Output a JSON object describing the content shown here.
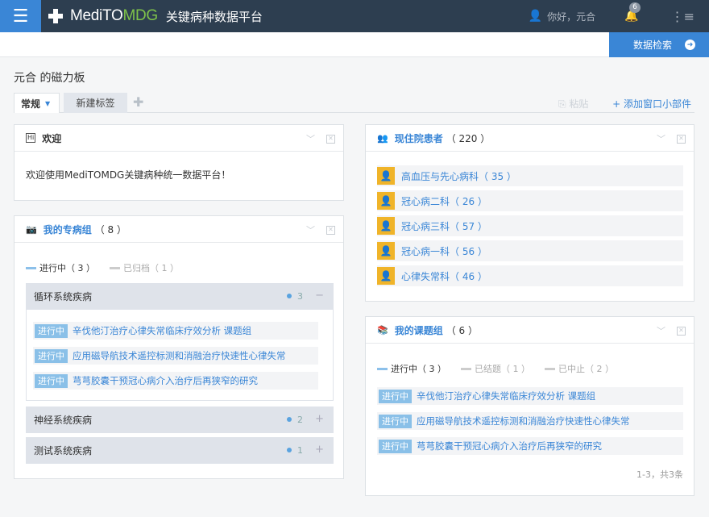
{
  "header": {
    "brand_main": "MediTO",
    "brand_accent": "MDG",
    "platform_title": "关键病种数据平台",
    "greeting": "你好，元合",
    "notification_count": "6"
  },
  "subbar": {
    "search_label": "数据检索"
  },
  "board": {
    "title": "元合 的磁力板"
  },
  "tabs": {
    "items": [
      {
        "label": "常规"
      },
      {
        "label": "新建标签"
      }
    ],
    "paste_label": "粘贴",
    "add_widget_label": "+ 添加窗口小部件"
  },
  "welcome": {
    "title": "欢迎",
    "message": "欢迎使用MediTOMDG关键病种统一数据平台！"
  },
  "disease_groups": {
    "title": "我的专病组",
    "count": "（ 8 ）",
    "filters": [
      {
        "label": "进行中（ 3 ）"
      },
      {
        "label": "已归档（ 1 ）"
      }
    ],
    "groups": [
      {
        "name": "循环系统疾病",
        "count": "3",
        "toggle": "−"
      },
      {
        "name": "神经系统疾病",
        "count": "2",
        "toggle": "+"
      },
      {
        "name": "测试系统疾病",
        "count": "1",
        "toggle": "+"
      }
    ],
    "items": [
      {
        "tag": "进行中",
        "text": "辛伐他汀治疗心律失常临床疗效分析 课题组"
      },
      {
        "tag": "进行中",
        "text": "应用磁导航技术遥控标测和消融治疗快速性心律失常"
      },
      {
        "tag": "进行中",
        "text": "芎芎胶囊干预冠心病介入治疗后再狭窄的研究"
      }
    ]
  },
  "inpatients": {
    "title": "现住院患者",
    "count": "（ 220 ）",
    "depts": [
      {
        "name": "高血压与先心病科（ 35 ）"
      },
      {
        "name": "冠心病二科（ 26 ）"
      },
      {
        "name": "冠心病三科（ 57 ）"
      },
      {
        "name": "冠心病一科（ 56 ）"
      },
      {
        "name": "心律失常科（ 46 ）"
      }
    ]
  },
  "projects": {
    "title": "我的课题组",
    "count": "（ 6 ）",
    "filters": [
      {
        "label": "进行中（ 3 ）"
      },
      {
        "label": "已结题（ 1 ）"
      },
      {
        "label": "已中止（ 2 ）"
      }
    ],
    "items": [
      {
        "tag": "进行中",
        "text": "辛伐他汀治疗心律失常临床疗效分析 课题组"
      },
      {
        "tag": "进行中",
        "text": "应用磁导航技术遥控标测和消融治疗快速性心律失常"
      },
      {
        "tag": "进行中",
        "text": "芎芎胶囊干预冠心病介入治疗后再狭窄的研究"
      }
    ],
    "pager": "1-3，共3条"
  },
  "colors": {
    "accent": "#3a86d6",
    "topbar": "#2d3e50",
    "logo_green": "#7fc34a",
    "avatar": "#f0b429"
  }
}
